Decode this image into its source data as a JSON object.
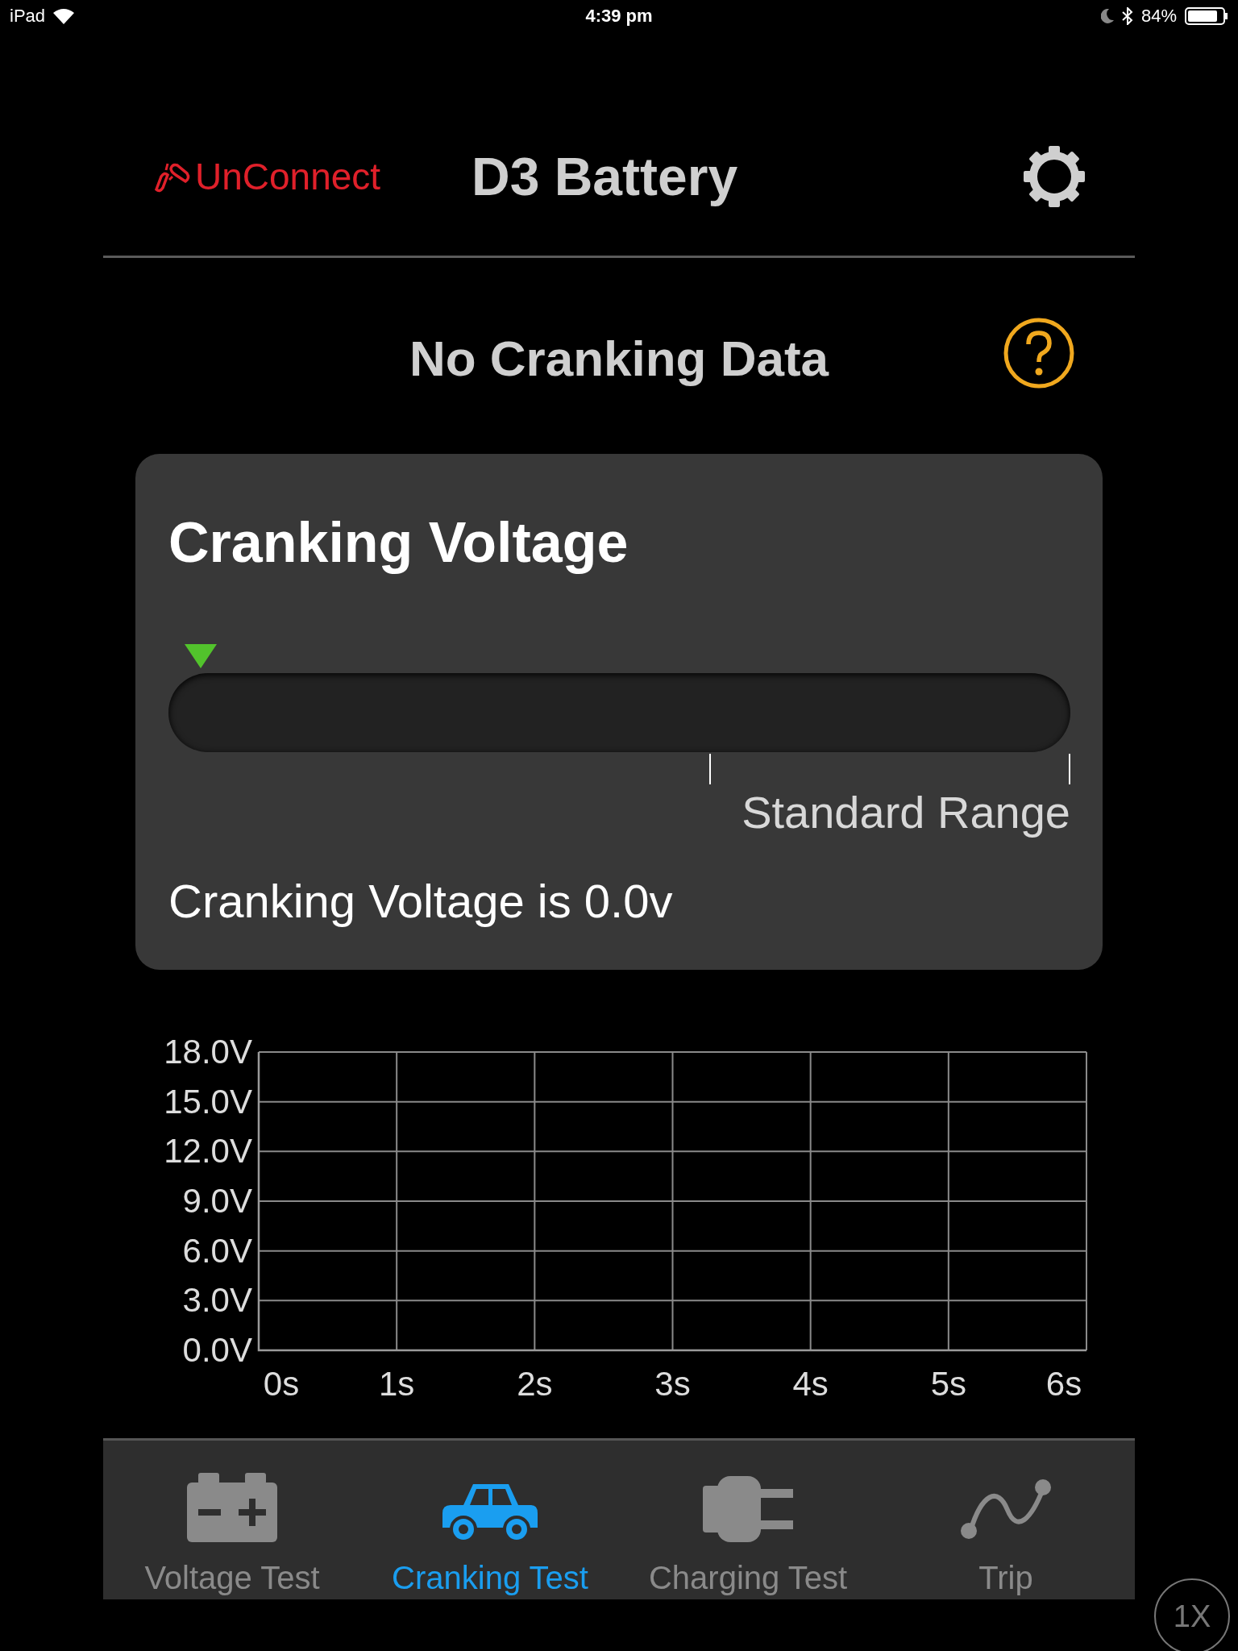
{
  "status_bar": {
    "device": "iPad",
    "time": "4:39 pm",
    "battery": "84%"
  },
  "header": {
    "connection": "UnConnect",
    "title": "D3 Battery"
  },
  "status_title": "No Cranking Data",
  "card": {
    "title": "Cranking Voltage",
    "range_label": "Standard Range",
    "reading": "Cranking Voltage is 0.0v"
  },
  "chart": {
    "chart_data": {
      "type": "line",
      "grid": true,
      "xlim": [
        0,
        6
      ],
      "ylim": [
        0,
        18
      ],
      "xticks": [
        {
          "value": 0,
          "label": "0s"
        },
        {
          "value": 1,
          "label": "1s"
        },
        {
          "value": 2,
          "label": "2s"
        },
        {
          "value": 3,
          "label": "3s"
        },
        {
          "value": 4,
          "label": "4s"
        },
        {
          "value": 5,
          "label": "5s"
        },
        {
          "value": 6,
          "label": "6s"
        }
      ],
      "yticks": [
        {
          "value": 0,
          "label": "0.0V"
        },
        {
          "value": 3,
          "label": "3.0V"
        },
        {
          "value": 6,
          "label": "6.0V"
        },
        {
          "value": 9,
          "label": "9.0V"
        },
        {
          "value": 12,
          "label": "12.0V"
        },
        {
          "value": 15,
          "label": "15.0V"
        },
        {
          "value": 18,
          "label": "18.0V"
        }
      ]
    }
  },
  "tabs": [
    {
      "label": "Voltage Test",
      "kind": "battery",
      "selected": false
    },
    {
      "label": "Cranking Test",
      "kind": "car",
      "selected": true
    },
    {
      "label": "Charging Test",
      "kind": "plug",
      "selected": false
    },
    {
      "label": "Trip",
      "kind": "trip",
      "selected": false
    }
  ],
  "speed_button": "1X"
}
